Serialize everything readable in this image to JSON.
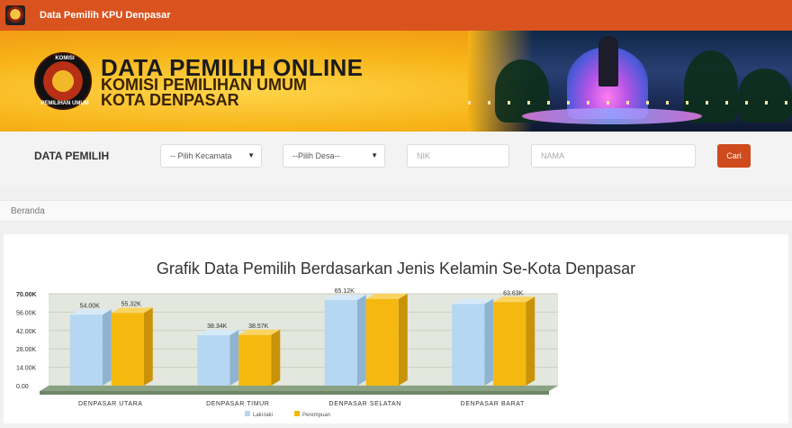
{
  "navbar": {
    "title": "Data Pemilih KPU Denpasar"
  },
  "banner": {
    "title": "DATA PEMILIH ONLINE",
    "subtitle1": "KOMISI PEMILIHAN UMUM",
    "subtitle2": "KOTA DENPASAR",
    "seal_top": "KOMISI",
    "seal_bottom": "PEMILIHAN UMUM"
  },
  "search": {
    "label": "DATA PEMILIH",
    "kecamatan_value": "-- Pilih Kecamata",
    "desa_value": "--Pilih Desa--",
    "nik_placeholder": "NIK",
    "nama_placeholder": "NAMA",
    "button_label": "Cari"
  },
  "breadcrumb": {
    "home": "Beranda"
  },
  "main": {
    "heading": "Grafik Data Pemilih Berdasarkan Jenis Kelamin Se-Kota Denpasar"
  },
  "colors": {
    "navbar": "#d9531e",
    "male": "#b5d7f2",
    "female": "#f4b80f",
    "button": "#cf4a1c"
  },
  "chart_data": {
    "type": "bar",
    "categories": [
      "DENPASAR UTARA",
      "DENPASAR TIMUR",
      "DENPASAR SELATAN",
      "DENPASAR BARAT"
    ],
    "series": [
      {
        "name": "Laki-laki",
        "values": [
          54000,
          38340,
          65120,
          62150
        ],
        "labels": [
          "54.00K",
          "38.34K",
          "65.12K",
          ""
        ]
      },
      {
        "name": "Perempuan",
        "values": [
          55320,
          38570,
          66000,
          63630
        ],
        "labels": [
          "55.32K",
          "38.57K",
          "",
          "63.63K"
        ]
      }
    ],
    "yticks": [
      "70.00K",
      "56.00K",
      "42.00K",
      "28.00K",
      "14.00K",
      "0.00"
    ],
    "ylim": [
      0,
      70000
    ],
    "legend": "bottom",
    "grid": true
  }
}
